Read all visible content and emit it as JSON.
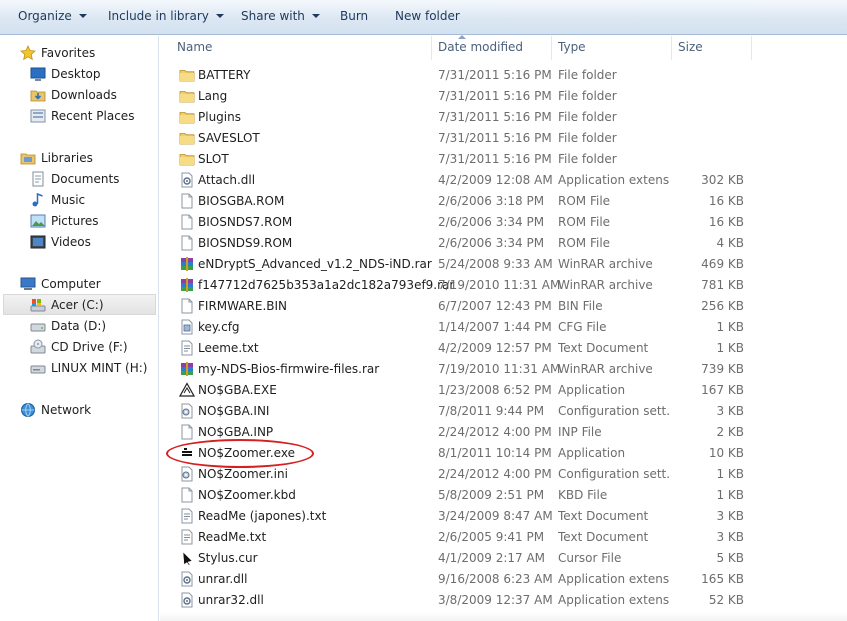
{
  "toolbar": {
    "organize": "Organize",
    "include_in_library": "Include in library",
    "share_with": "Share with",
    "burn": "Burn",
    "new_folder": "New folder"
  },
  "nav": {
    "favorites": "Favorites",
    "desktop": "Desktop",
    "downloads": "Downloads",
    "recent_places": "Recent Places",
    "libraries": "Libraries",
    "documents": "Documents",
    "music": "Music",
    "pictures": "Pictures",
    "videos": "Videos",
    "computer": "Computer",
    "acer": "Acer (C:)",
    "data": "Data (D:)",
    "cd_drive": "CD Drive (F:)",
    "linux_mint": "LINUX MINT (H:)",
    "network": "Network"
  },
  "columns": {
    "name": "Name",
    "date_modified": "Date modified",
    "type": "Type",
    "size": "Size"
  },
  "files": [
    {
      "name": "BATTERY",
      "date": "7/31/2011 5:16 PM",
      "type": "File folder",
      "size": "",
      "icon": "folder"
    },
    {
      "name": "Lang",
      "date": "7/31/2011 5:16 PM",
      "type": "File folder",
      "size": "",
      "icon": "folder"
    },
    {
      "name": "Plugins",
      "date": "7/31/2011 5:16 PM",
      "type": "File folder",
      "size": "",
      "icon": "folder"
    },
    {
      "name": "SAVESLOT",
      "date": "7/31/2011 5:16 PM",
      "type": "File folder",
      "size": "",
      "icon": "folder"
    },
    {
      "name": "SLOT",
      "date": "7/31/2011 5:16 PM",
      "type": "File folder",
      "size": "",
      "icon": "folder"
    },
    {
      "name": "Attach.dll",
      "date": "4/2/2009 12:08 AM",
      "type": "Application extens...",
      "size": "302 KB",
      "icon": "dll"
    },
    {
      "name": "BIOSGBA.ROM",
      "date": "2/6/2006 3:18 PM",
      "type": "ROM File",
      "size": "16 KB",
      "icon": "blank"
    },
    {
      "name": "BIOSNDS7.ROM",
      "date": "2/6/2006 3:34 PM",
      "type": "ROM File",
      "size": "16 KB",
      "icon": "blank"
    },
    {
      "name": "BIOSNDS9.ROM",
      "date": "2/6/2006 3:34 PM",
      "type": "ROM File",
      "size": "4 KB",
      "icon": "blank"
    },
    {
      "name": "eNDryptS_Advanced_v1.2_NDS-iND.rar",
      "date": "5/24/2008 9:33 AM",
      "type": "WinRAR archive",
      "size": "469 KB",
      "icon": "rar"
    },
    {
      "name": "f147712d7625b353a1a2dc182a793ef9.rar",
      "date": "7/19/2010 11:31 AM",
      "type": "WinRAR archive",
      "size": "781 KB",
      "icon": "rar"
    },
    {
      "name": "FIRMWARE.BIN",
      "date": "6/7/2007 12:43 PM",
      "type": "BIN File",
      "size": "256 KB",
      "icon": "blank"
    },
    {
      "name": "key.cfg",
      "date": "1/14/2007 1:44 PM",
      "type": "CFG File",
      "size": "1 KB",
      "icon": "cfg"
    },
    {
      "name": "Leeme.txt",
      "date": "4/2/2009 12:57 PM",
      "type": "Text Document",
      "size": "1 KB",
      "icon": "txt"
    },
    {
      "name": "my-NDS-Bios-firmwire-files.rar",
      "date": "7/19/2010 11:31 AM",
      "type": "WinRAR archive",
      "size": "739 KB",
      "icon": "rar"
    },
    {
      "name": "NO$GBA.EXE",
      "date": "1/23/2008 6:52 PM",
      "type": "Application",
      "size": "167 KB",
      "icon": "nogba"
    },
    {
      "name": "NO$GBA.INI",
      "date": "7/8/2011 9:44 PM",
      "type": "Configuration sett...",
      "size": "3 KB",
      "icon": "ini"
    },
    {
      "name": "NO$GBA.INP",
      "date": "2/24/2012 4:00 PM",
      "type": "INP File",
      "size": "2 KB",
      "icon": "blank"
    },
    {
      "name": "NO$Zoomer.exe",
      "date": "8/1/2011 10:14 PM",
      "type": "Application",
      "size": "10 KB",
      "icon": "zoomer"
    },
    {
      "name": "NO$Zoomer.ini",
      "date": "2/24/2012 4:00 PM",
      "type": "Configuration sett...",
      "size": "1 KB",
      "icon": "ini"
    },
    {
      "name": "NO$Zoomer.kbd",
      "date": "5/8/2009 2:51 PM",
      "type": "KBD File",
      "size": "1 KB",
      "icon": "blank"
    },
    {
      "name": "ReadMe (japones).txt",
      "date": "3/24/2009 8:47 AM",
      "type": "Text Document",
      "size": "3 KB",
      "icon": "txt"
    },
    {
      "name": "ReadMe.txt",
      "date": "2/6/2005 9:41 PM",
      "type": "Text Document",
      "size": "3 KB",
      "icon": "txt"
    },
    {
      "name": "Stylus.cur",
      "date": "4/1/2009 2:17 AM",
      "type": "Cursor File",
      "size": "5 KB",
      "icon": "cursor"
    },
    {
      "name": "unrar.dll",
      "date": "9/16/2008 6:23 AM",
      "type": "Application extens...",
      "size": "165 KB",
      "icon": "dll"
    },
    {
      "name": "unrar32.dll",
      "date": "3/8/2009 12:37 AM",
      "type": "Application extens...",
      "size": "52 KB",
      "icon": "dll"
    }
  ]
}
